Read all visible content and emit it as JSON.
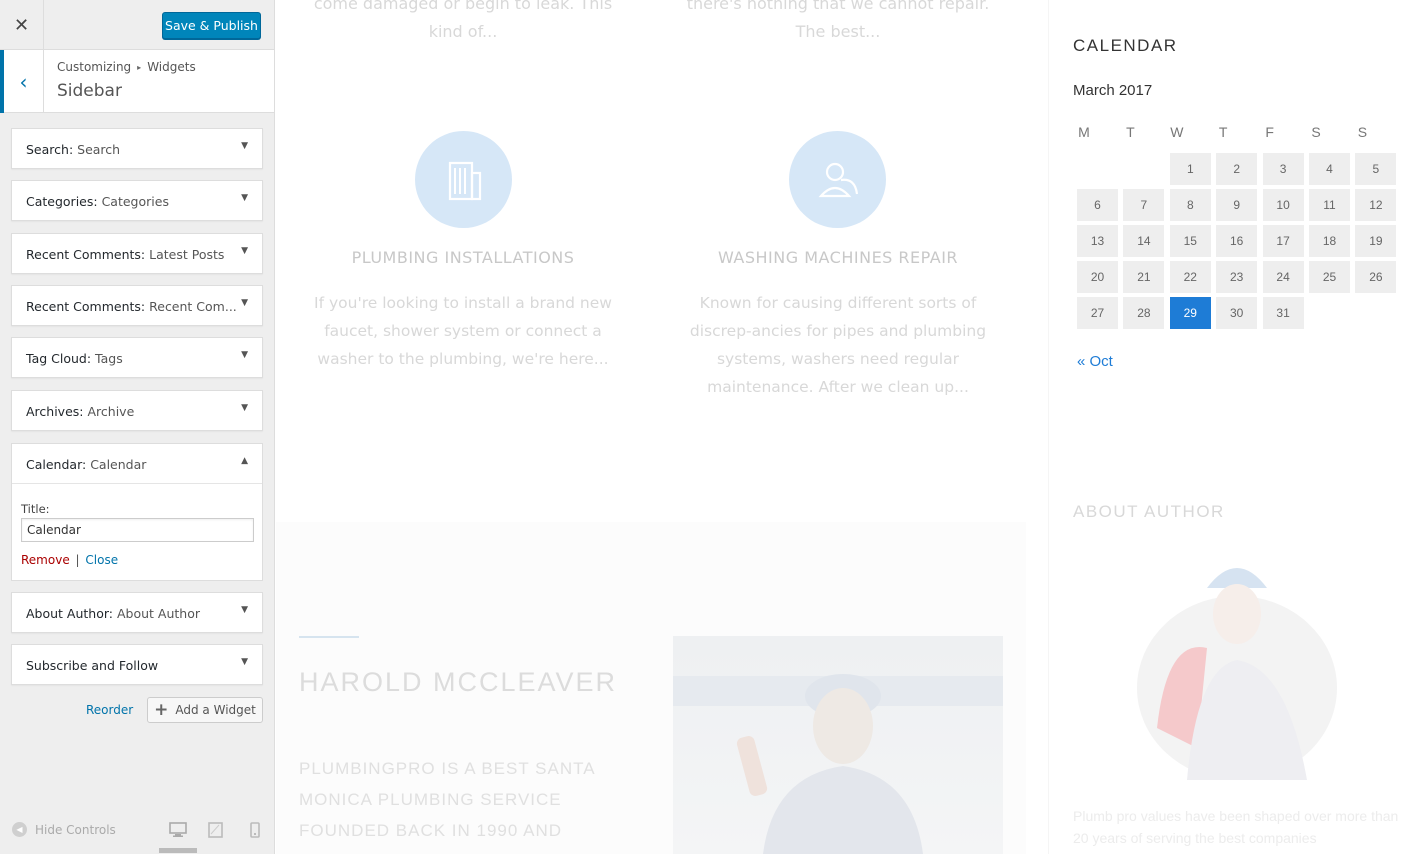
{
  "customizer": {
    "close_glyph": "✕",
    "save_label": "Save & Publish",
    "back_glyph": "‹",
    "breadcrumb": {
      "root": "Customizing",
      "separator": "▸",
      "current": "Widgets"
    },
    "section_title": "Sidebar",
    "widgets": [
      {
        "type": "Search:",
        "title": "Search"
      },
      {
        "type": "Categories:",
        "title": "Categories"
      },
      {
        "type": "Recent Comments:",
        "title": "Latest Posts"
      },
      {
        "type": "Recent Comments:",
        "title": "Recent Com..."
      },
      {
        "type": "Tag Cloud:",
        "title": "Tags"
      },
      {
        "type": "Archives:",
        "title": "Archive"
      }
    ],
    "open_widget": {
      "type": "Calendar:",
      "title": "Calendar",
      "field_label": "Title:",
      "field_value": "Calendar",
      "remove_label": "Remove",
      "separator": "|",
      "close_label": "Close"
    },
    "widgets_after": [
      {
        "type": "About Author:",
        "title": "About Author"
      },
      {
        "type": "Subscribe and Follow",
        "title": ""
      }
    ],
    "reorder_label": "Reorder",
    "add_widget_label": "Add a Widget",
    "hide_controls_label": "Hide Controls",
    "arrow_down": "▼",
    "arrow_up": "▲",
    "accent_color": "#0085ba"
  },
  "preview": {
    "services_top": [
      {
        "text": "come damaged or begin to leak. This kind of..."
      },
      {
        "text": "there's nothing that we cannot repair. The best..."
      }
    ],
    "services": [
      {
        "title": "PLUMBING INSTALLATIONS",
        "text": "If you're looking to install a brand new faucet, shower system or connect a washer to the plumbing, we're here...",
        "icon": "building-icon"
      },
      {
        "title": "WASHING MACHINES REPAIR",
        "text": "Known for causing different sorts of discrep-ancies for pipes and plumbing systems, washers need regular maintenance. After we clean up...",
        "icon": "worker-icon"
      }
    ],
    "team": {
      "name": "HAROLD MCCLEAVER",
      "bio": "PLUMBINGPRO IS A BEST SANTA MONICA PLUMBING SERVICE FOUNDED BACK IN 1990 AND"
    },
    "calendar": {
      "heading": "CALENDAR",
      "month": "March 2017",
      "weekdays": [
        "M",
        "T",
        "W",
        "T",
        "F",
        "S",
        "S"
      ],
      "first_weekday_index": 2,
      "days_in_month": 31,
      "today": 29,
      "prev_link": "« Oct",
      "highlight_color": "#1e7cd6"
    },
    "about": {
      "heading": "ABOUT AUTHOR",
      "text": "Plumb pro values have been shaped over more than 20 years of serving the best companies"
    }
  }
}
